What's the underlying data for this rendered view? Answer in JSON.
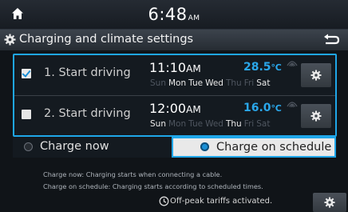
{
  "status_bar": {
    "time": "6:48",
    "ampm": "AM"
  },
  "header": {
    "title": "Charging and climate settings"
  },
  "schedules": [
    {
      "checked": true,
      "label": "1. Start driving",
      "time": "11:10",
      "ampm": "AM",
      "temperature": "28.5",
      "unit": "℃",
      "days": [
        {
          "name": "Sun",
          "active": false
        },
        {
          "name": "Mon",
          "active": true
        },
        {
          "name": "Tue",
          "active": true
        },
        {
          "name": "Wed",
          "active": true
        },
        {
          "name": "Thu",
          "active": false
        },
        {
          "name": "Fri",
          "active": false
        },
        {
          "name": "Sat",
          "active": true
        }
      ]
    },
    {
      "checked": false,
      "label": "2. Start driving",
      "time": "12:00",
      "ampm": "AM",
      "temperature": "16.0",
      "unit": "℃",
      "days": [
        {
          "name": "Sun",
          "active": true
        },
        {
          "name": "Mon",
          "active": false
        },
        {
          "name": "Tue",
          "active": false
        },
        {
          "name": "Wed",
          "active": false
        },
        {
          "name": "Thu",
          "active": true
        },
        {
          "name": "Fri",
          "active": false
        },
        {
          "name": "Sat",
          "active": false
        }
      ]
    }
  ],
  "charge_options": {
    "now_label": "Charge now",
    "schedule_label": "Charge on schedule",
    "selected": "schedule"
  },
  "notes": {
    "line1": "Charge now: Charging starts when connecting a cable.",
    "line2": "Charge on schedule: Charging starts according to scheduled times."
  },
  "off_peak": {
    "label": "Off-peak tariffs activated."
  },
  "colors": {
    "accent": "#1fa6e8",
    "temperature": "#2aa7ea",
    "background": "#101418"
  },
  "icons": [
    "home-icon",
    "gear-icon",
    "back-icon",
    "fan-icon",
    "clock-plug-icon"
  ]
}
